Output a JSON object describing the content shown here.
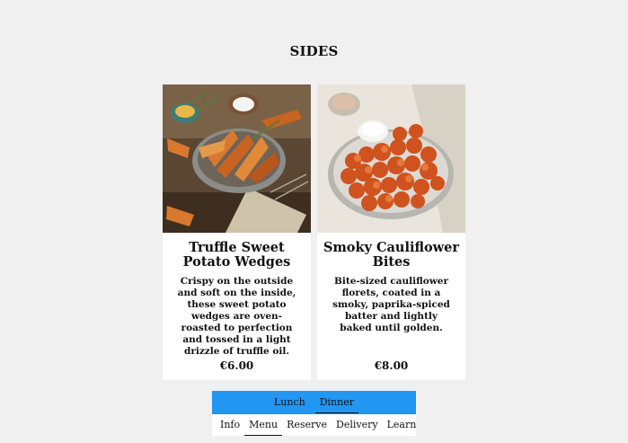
{
  "page": {
    "section_title": "SIDES"
  },
  "items": [
    {
      "name": "Truffle Sweet Potato Wedges",
      "description": "Crispy on the outside and soft on the inside, these sweet potato wedges are oven-roasted to perfection and tossed in a light drizzle of truffle oil.",
      "price": "€6.00"
    },
    {
      "name": "Smoky Cauliflower Bites",
      "description": "Bite-sized cauliflower florets, coated in a smoky, paprika-spiced batter and lightly baked until golden.",
      "price": "€8.00"
    }
  ],
  "meal_tabs": [
    {
      "label": "Lunch",
      "active": false
    },
    {
      "label": "Dinner",
      "active": true
    }
  ],
  "nav": [
    {
      "label": "Info",
      "active": false
    },
    {
      "label": "Menu",
      "active": true
    },
    {
      "label": "Reserve",
      "active": false
    },
    {
      "label": "Delivery",
      "active": false
    },
    {
      "label": "Learn",
      "active": false
    }
  ],
  "colors": {
    "meal_bar": "#2196f3",
    "background": "#f0f0f0"
  }
}
